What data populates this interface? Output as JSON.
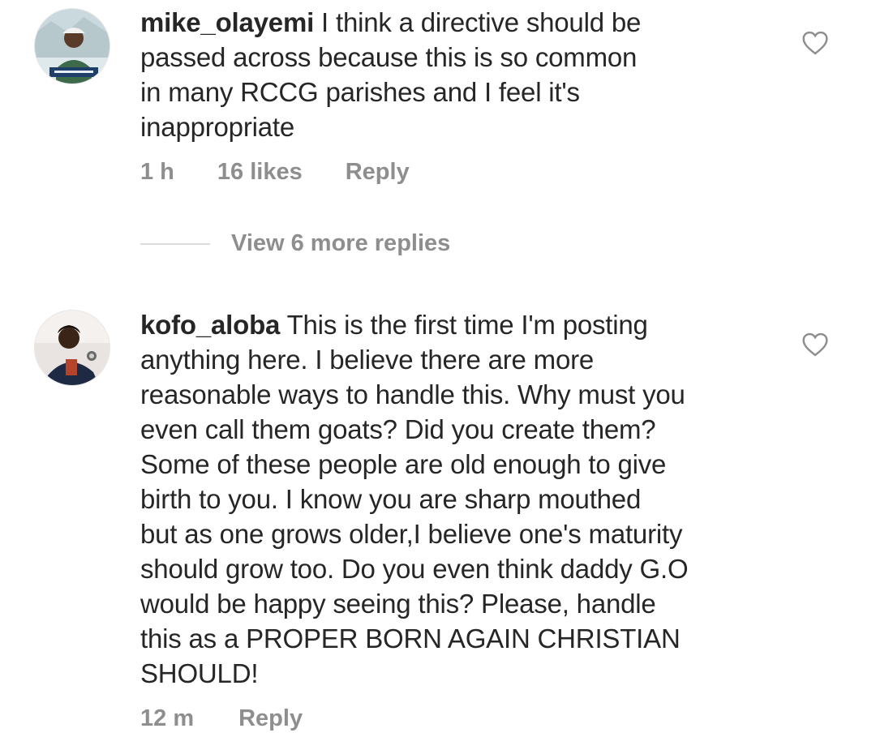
{
  "comments": [
    {
      "username": "mike_olayemi",
      "text": " I think a directive should be\npassed across because this is so common\nin many RCCG parishes and I feel it's\ninappropriate",
      "time": "1 h",
      "likes": "16 likes",
      "reply_label": "Reply",
      "avatar_icon": "profile-photo-icon"
    },
    {
      "username": "kofo_aloba",
      "text": " This is the first time I'm posting\nanything here. I believe there are more\nreasonable ways to handle this. Why must you\neven call them goats? Did you create them?\nSome of these people are old enough to give\nbirth to you. I know you are sharp mouthed\nbut as one grows older,I believe one's maturity\nshould grow too. Do you even think daddy G.O\nwould be happy seeing this? Please, handle\nthis as a PROPER BORN AGAIN CHRISTIAN\nSHOULD!",
      "time": "12 m",
      "reply_label": "Reply",
      "avatar_icon": "profile-photo-icon"
    }
  ],
  "view_replies": "View 6 more replies",
  "colors": {
    "text": "#262626",
    "muted": "#8e8e8e",
    "divider": "#dbdbdb"
  }
}
